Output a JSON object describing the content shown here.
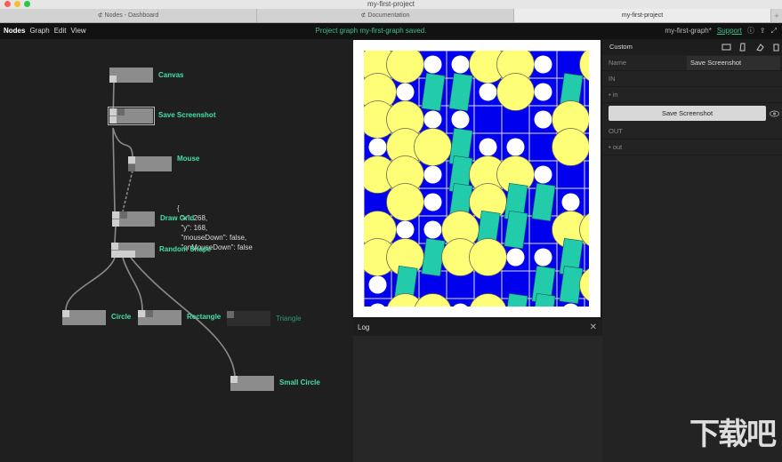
{
  "window": {
    "title": "my-first-project"
  },
  "tabs": [
    {
      "label": "⊄ Nodes - Dashboard"
    },
    {
      "label": "⊄ Documentation"
    },
    {
      "label": "my-first-project"
    }
  ],
  "menu": {
    "items": [
      "Nodes",
      "Graph",
      "Edit",
      "View"
    ],
    "status": "Project graph my-first-graph saved.",
    "graph_name": "my-first-graph*",
    "support": "Support"
  },
  "graph": {
    "nodes": {
      "canvas": "Canvas",
      "save": "Save Screenshot",
      "mouse": "Mouse",
      "draw_grid": "Draw Grid",
      "random_shape": "Random Shape",
      "circle": "Circle",
      "rectangle": "Rectangle",
      "triangle": "Triangle",
      "small_circle": "Small Circle"
    },
    "mouse_value": "{\n  \"x\": 268,\n  \"y\": 168,\n  \"mouseDown\": false,\n  \"onMouseDown\": false"
  },
  "log": {
    "title": "Log"
  },
  "inspector": {
    "title": "Custom",
    "name_label": "Name",
    "name_value": "Save Screenshot",
    "in_header": "IN",
    "in_port": "• in",
    "button": "Save Screenshot",
    "out_header": "OUT",
    "out_port": "• out"
  },
  "watermark": "下载吧",
  "colors": {
    "accent": "#44e0a5",
    "canvas_bg": "#0000ee",
    "yellow": "#ffff77",
    "teal": "#22ccaa"
  }
}
